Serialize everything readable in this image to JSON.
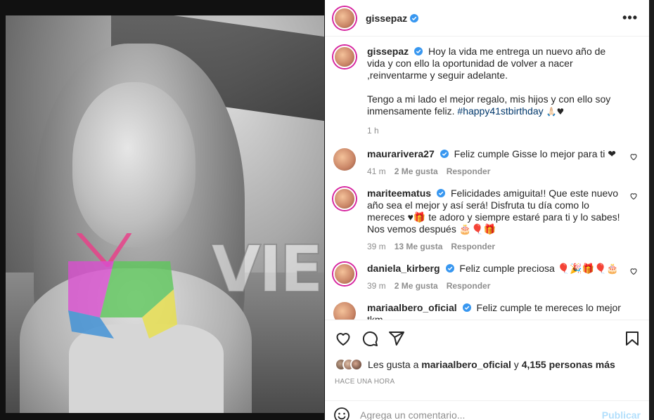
{
  "post": {
    "username": "gissepaz",
    "more_label": "•••",
    "caption": {
      "username": "gissepaz",
      "text_1": "Hoy la vida me entrega un nuevo año de vida y con ello la oportunidad de volver a nacer ,reinventarme y seguir adelante.",
      "text_2": "Tengo a mi lado el mejor regalo, mis hijos y con ello soy inmensamente feliz. ",
      "hashtag": "#happy41stbirthday",
      "emoji": "🙏🏻♥",
      "time": "1 h"
    },
    "comments": [
      {
        "username": "maurarivera27",
        "text": "Feliz cumple Gisse lo mejor para ti ❤",
        "time": "41 m",
        "likes": "2 Me gusta",
        "reply": "Responder"
      },
      {
        "username": "mariteematus",
        "text": "Felicidades amiguita!! Que este nuevo año sea el mejor y así será! Disfruta tu día como lo mereces ♥🎁 te adoro y siempre estaré para ti y lo sabes! Nos vemos después 🎂🎈🎁",
        "time": "39 m",
        "likes": "13 Me gusta",
        "reply": "Responder"
      },
      {
        "username": "daniela_kirberg",
        "text": "Feliz cumple preciosa 🎈🎉🎁🎈🎂",
        "time": "39 m",
        "likes": "2 Me gusta",
        "reply": "Responder"
      },
      {
        "username": "mariaalbero_oficial",
        "text": "Feliz cumple te mereces lo mejor tkm"
      }
    ],
    "likes": {
      "prefix": "Les gusta a",
      "user": "mariaalbero_oficial",
      "middle": "y",
      "count": "4,155 personas más"
    },
    "timestamp": "HACE UNA HORA",
    "comment_box": {
      "placeholder": "Agrega un comentario...",
      "publish": "Publicar"
    }
  },
  "watermark": "VIEMBOX",
  "colors": {
    "verified": "#3897f0",
    "hashtag": "#00376b",
    "publish_disabled": "#b2dffc",
    "muted": "#8e8e8e"
  },
  "icons": [
    "more-icon",
    "verified-icon",
    "heart-icon",
    "comment-icon",
    "share-icon",
    "save-icon",
    "smile-icon"
  ]
}
